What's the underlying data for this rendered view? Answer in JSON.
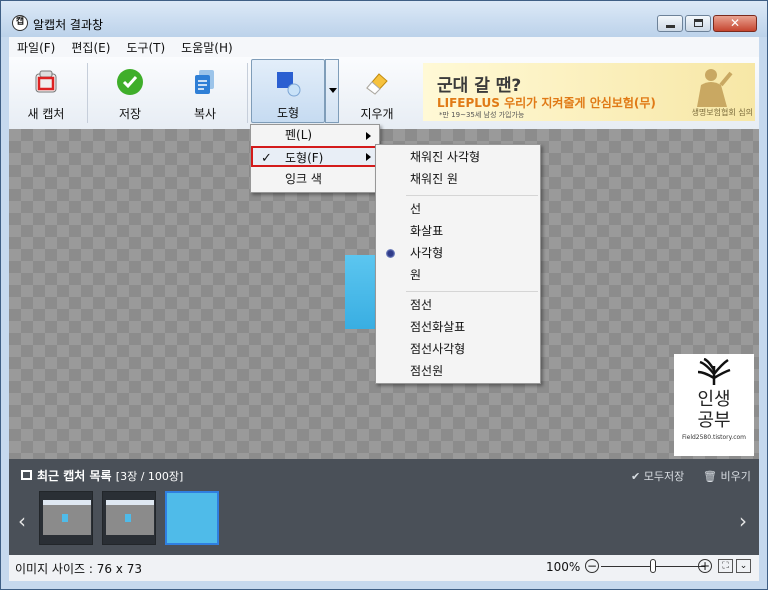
{
  "window": {
    "title": "알캡처 결과창",
    "app_icon": "캡"
  },
  "menubar": [
    "파일(F)",
    "편집(E)",
    "도구(T)",
    "도움말(H)"
  ],
  "toolbar": {
    "new_capture": "새 캡처",
    "save": "저장",
    "copy": "복사",
    "shape": "도형",
    "eraser": "지우개"
  },
  "ad": {
    "title": "군대 갈 땐?",
    "subtitle": "LIFEPLUS 우리가 지켜줄게 안심보험(무)",
    "small": "*만 19~35세 남성 가입가능",
    "brand": "생명보험협회 심의"
  },
  "shape_menu": {
    "items": [
      "펜(L)",
      "도형(F)",
      "잉크 색"
    ],
    "checked": "✓"
  },
  "shape_submenu": {
    "group1": [
      "채워진 사각형",
      "채워진 원"
    ],
    "group2": [
      "선",
      "화살표",
      "사각형",
      "원"
    ],
    "group3": [
      "점선",
      "점선화살표",
      "점선사각형",
      "점선원"
    ],
    "selected": "사각형"
  },
  "watermark": {
    "line1": "인생",
    "line2": "공부",
    "url": "Field2580.tistory.com"
  },
  "recent": {
    "title": "최근 캡처 목록",
    "count": "[3장 / 100장]",
    "save_all": "✔ 모두저장",
    "clear": "🗑 비우기"
  },
  "status": {
    "image_size": "이미지 사이즈 : 76 x 73",
    "zoom": "100%",
    "zoom_level": 0.5
  },
  "colors": {
    "capture_blue": "#4fbbe9",
    "highlight_red": "#d41b1b"
  }
}
